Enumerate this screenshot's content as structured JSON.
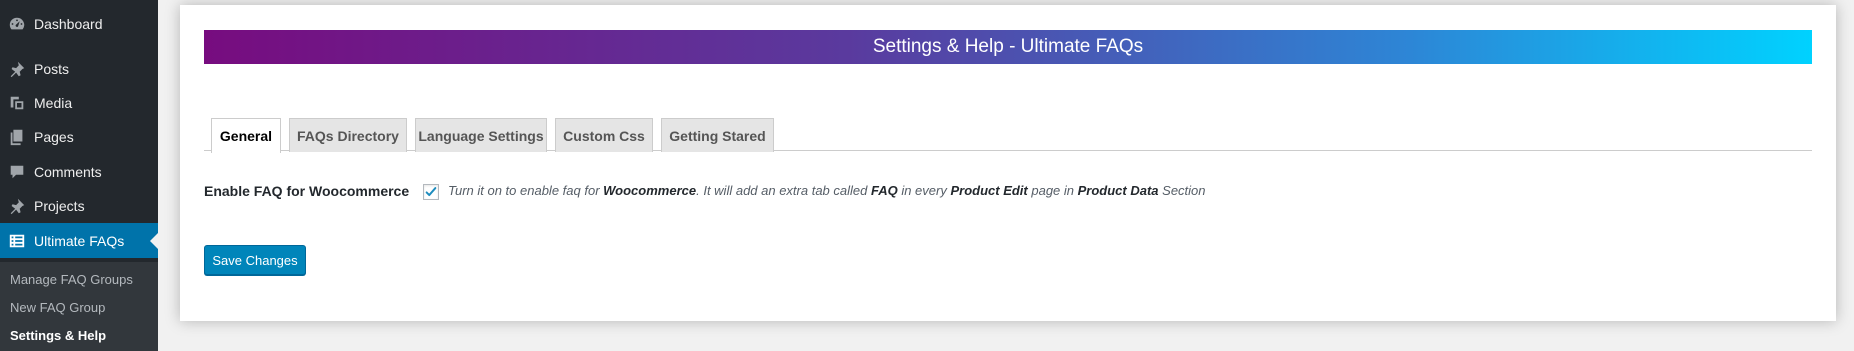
{
  "sidebar": {
    "items": [
      {
        "label": "Dashboard",
        "icon": "dashboard-icon"
      },
      {
        "label": "Posts",
        "icon": "pin-icon"
      },
      {
        "label": "Media",
        "icon": "media-icon"
      },
      {
        "label": "Pages",
        "icon": "pages-icon"
      },
      {
        "label": "Comments",
        "icon": "comment-icon"
      },
      {
        "label": "Projects",
        "icon": "pin-icon"
      },
      {
        "label": "Ultimate FAQs",
        "icon": "list-icon",
        "current": true
      }
    ],
    "submenu": [
      {
        "label": "Manage FAQ Groups"
      },
      {
        "label": "New FAQ Group"
      },
      {
        "label": "Settings & Help",
        "current": true
      }
    ]
  },
  "banner": {
    "title": "Settings & Help - Ultimate FAQs",
    "gradient_start": "#770c7f",
    "gradient_end": "#00d2ff"
  },
  "tabs": [
    {
      "label": "General",
      "active": true
    },
    {
      "label": "FAQs Directory"
    },
    {
      "label": "Language Settings"
    },
    {
      "label": "Custom Css"
    },
    {
      "label": "Getting Stared"
    }
  ],
  "settings": {
    "woocommerce": {
      "label": "Enable FAQ for Woocommerce",
      "checked": true,
      "desc_1": "Turn it on to enable faq for ",
      "desc_b1": "Woocommerce",
      "desc_2": ". It will add an extra tab called ",
      "desc_b2": "FAQ",
      "desc_3": " in every ",
      "desc_b3": "Product Edit",
      "desc_4": " page in ",
      "desc_b4": "Product Data",
      "desc_5": " Section"
    }
  },
  "save_button": {
    "label": "Save Changes"
  },
  "colors": {
    "sidebar_bg": "#23282d",
    "accent": "#0073aa",
    "button": "#0085ba"
  }
}
